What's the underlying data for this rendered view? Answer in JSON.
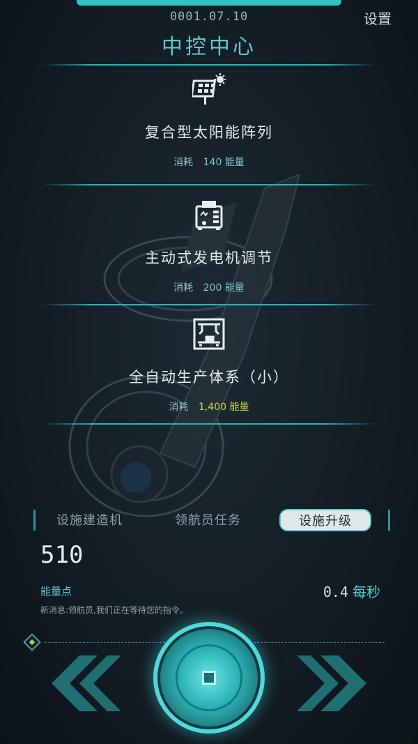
{
  "header": {
    "date": "0001.07.10",
    "settings_label": "设置",
    "title": "中控中心"
  },
  "items": [
    {
      "icon": "solar-panel-icon",
      "name": "复合型太阳能阵列",
      "cost_label": "消耗",
      "cost_value": "140 能量",
      "cost_color": "#7ec8cc"
    },
    {
      "icon": "generator-icon",
      "name": "主动式发电机调节",
      "cost_label": "消耗",
      "cost_value": "200 能量",
      "cost_color": "#7ec8cc"
    },
    {
      "icon": "factory-arm-icon",
      "name": "全自动生产体系（小）",
      "cost_label": "消耗",
      "cost_value": "1,400 能量",
      "cost_color": "#c9d84c"
    }
  ],
  "tabs": [
    {
      "label": "设施建造机",
      "active": false
    },
    {
      "label": "领航员任务",
      "active": false
    },
    {
      "label": "设施升级",
      "active": true
    }
  ],
  "energy": {
    "value": "510",
    "label": "能量点",
    "rate": "0.4",
    "rate_unit": "每秒"
  },
  "message": "新消息:领航员,我们正在等待您的指令。",
  "controls": {
    "left_icon": "double-chevron-left-icon",
    "center_icon": "core-button-icon",
    "right_icon": "double-chevron-right-icon"
  },
  "colors": {
    "accent": "#2fc3c3",
    "highlight": "#c9d84c",
    "background": "#131d24"
  }
}
